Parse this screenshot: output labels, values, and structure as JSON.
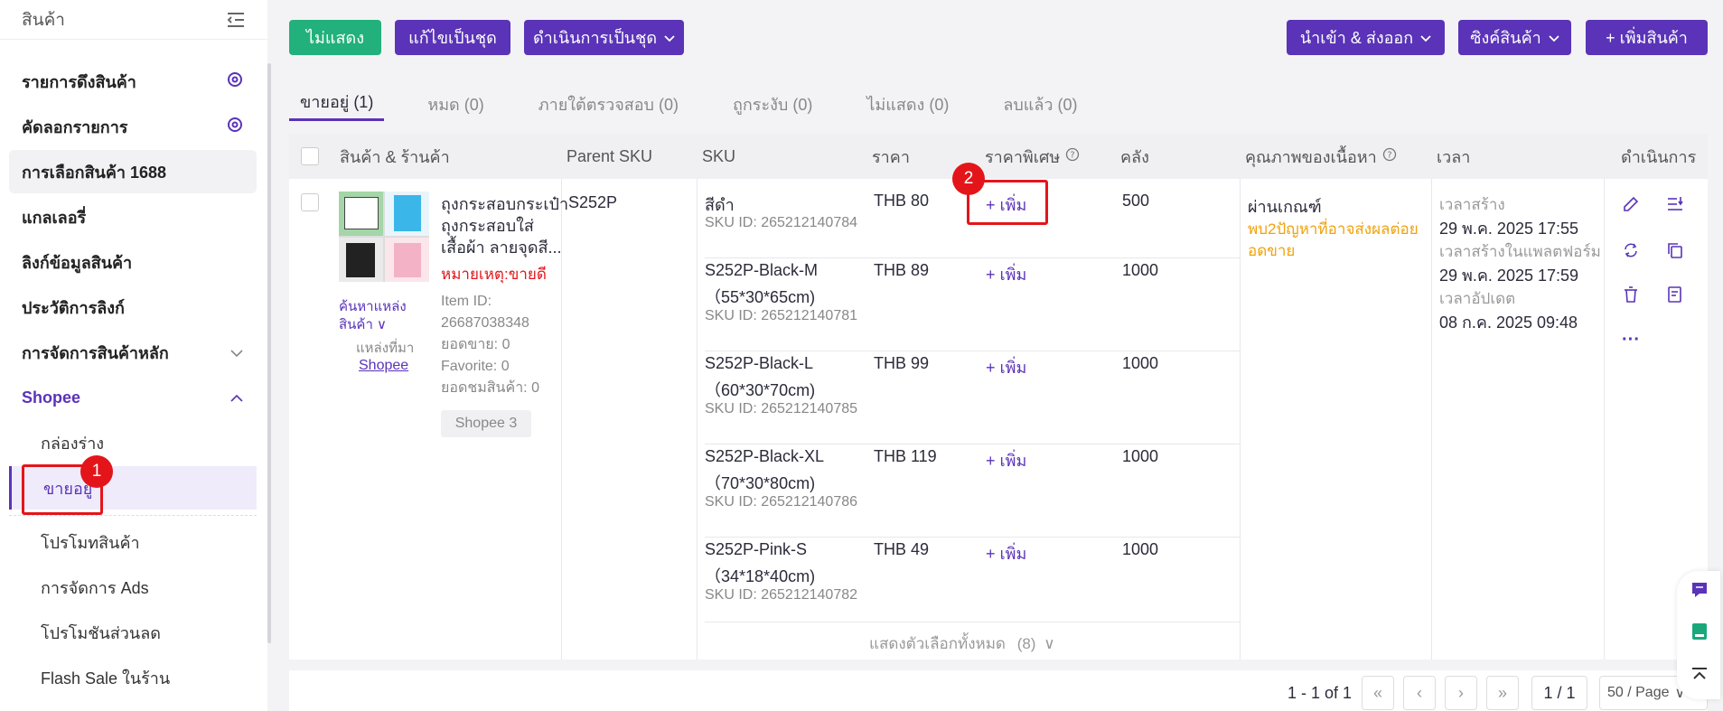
{
  "sidebar": {
    "title": "สินค้า",
    "items": [
      {
        "label": "รายการดึงสินค้า"
      },
      {
        "label": "คัดลอกรายการ"
      },
      {
        "label": "การเลือกสินค้า 1688"
      },
      {
        "label": "แกลเลอรี่"
      },
      {
        "label": "ลิงก์ข้อมูลสินค้า"
      },
      {
        "label": "ประวัติการลิงก์"
      },
      {
        "label": "การจัดการสินค้าหลัก"
      },
      {
        "label": "Shopee"
      }
    ],
    "sub_items": [
      {
        "label": "กล่องร่าง"
      },
      {
        "label": "ขายอยู่"
      },
      {
        "label": "โปรโมทสินค้า"
      },
      {
        "label": "การจัดการ Ads"
      },
      {
        "label": "โปรโมชันส่วนลด"
      },
      {
        "label": "Flash Sale ในร้าน"
      }
    ]
  },
  "toolbar": {
    "hide": "ไม่แสดง",
    "bulk_edit": "แก้ไขเป็นชุด",
    "bulk_action": "ดำเนินการเป็นชุด",
    "import_export": "นำเข้า & ส่งออก",
    "sync": "ซิงค์สินค้า",
    "add_product": "+ เพิ่มสินค้า"
  },
  "tabs": [
    {
      "label": "ขายอยู่ (1)"
    },
    {
      "label": "หมด (0)"
    },
    {
      "label": "ภายใต้ตรวจสอบ (0)"
    },
    {
      "label": "ถูกระงับ (0)"
    },
    {
      "label": "ไม่แสดง (0)"
    },
    {
      "label": "ลบแล้ว (0)"
    }
  ],
  "table": {
    "headers": {
      "product": "สินค้า & ร้านค้า",
      "parent_sku": "Parent SKU",
      "sku": "SKU",
      "price": "ราคา",
      "special_price": "ราคาพิเศษ",
      "stock": "คลัง",
      "quality": "คุณภาพของเนื้อหา",
      "time": "เวลา",
      "actions": "ดำเนินการ"
    },
    "product": {
      "name_line1": "ถุงกระสอบกระเป๋า",
      "name_line2": "ถุงกระสอบใส่",
      "name_line3": "เสื้อผ้า ลายจุดสี...",
      "note": "หมายเหตุ:ขายดี",
      "item_id_label": "Item ID:",
      "item_id": "26687038348",
      "sales": "ยอดขาย: 0",
      "favorite": "Favorite: 0",
      "views": "ยอดชมสินค้า: 0",
      "find_source_1": "ค้นหาแหล่ง",
      "find_source_2": "สินค้า",
      "source_label": "แหล่งที่มา",
      "source": "Shopee",
      "store_tag": "Shopee 3",
      "parent_sku": "S252P"
    },
    "variants": [
      {
        "sku": "สีดำ",
        "sku2": "",
        "sku_id": "SKU ID: 265212140784",
        "price": "THB 80",
        "special": "+ เพิ่ม",
        "stock": "500"
      },
      {
        "sku": "S252P-Black-M",
        "sku2": "（55*30*65cm)",
        "sku_id": "SKU ID: 265212140781",
        "price": "THB 89",
        "special": "+ เพิ่ม",
        "stock": "1000"
      },
      {
        "sku": "S252P-Black-L",
        "sku2": "（60*30*70cm)",
        "sku_id": "SKU ID: 265212140785",
        "price": "THB 99",
        "special": "+ เพิ่ม",
        "stock": "1000"
      },
      {
        "sku": "S252P-Black-XL",
        "sku2": "（70*30*80cm)",
        "sku_id": "SKU ID: 265212140786",
        "price": "THB 119",
        "special": "+ เพิ่ม",
        "stock": "1000"
      },
      {
        "sku": "S252P-Pink-S",
        "sku2": "（34*18*40cm)",
        "sku_id": "SKU ID: 265212140782",
        "price": "THB 49",
        "special": "+ เพิ่ม",
        "stock": "1000"
      }
    ],
    "show_all": "แสดงตัวเลือกทั้งหมด",
    "show_all_count": "(8)",
    "quality": {
      "status": "ผ่านเกณฑ์",
      "issues_1": "พบ2ปัญหาที่อาจส่งผลต่อย",
      "issues_2": "อดขาย"
    },
    "time": {
      "created_label": "เวลาสร้าง",
      "created": "29 พ.ค. 2025 17:55",
      "platform_created_label": "เวลาสร้างในแพลตฟอร์ม",
      "platform_created": "29 พ.ค. 2025 17:59",
      "updated_label": "เวลาอัปเดต",
      "updated": "08 ก.ค. 2025 09:48"
    }
  },
  "pagination": {
    "summary": "1 - 1 of 1",
    "page": "1 / 1",
    "per_page": "50 / Page"
  },
  "annotations": {
    "badge1": "1",
    "badge2": "2"
  },
  "colors": {
    "accent": "#5a33b8",
    "green": "#22b17c",
    "highlight": "#e4151a",
    "warning": "#f0a20d"
  }
}
